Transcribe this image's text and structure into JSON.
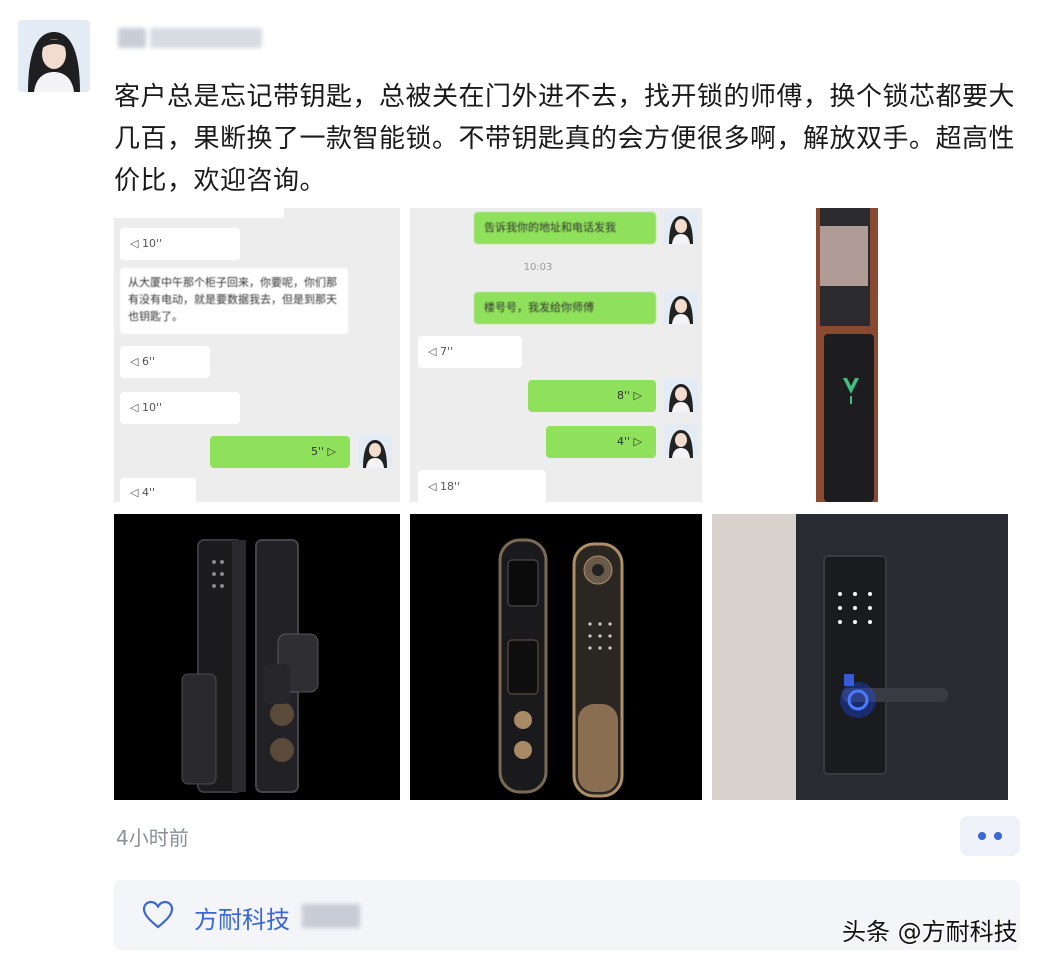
{
  "post": {
    "text": "客户总是忘记带钥匙，总被关在门外进不去，找开锁的师傅，换个锁芯都要大几百，果断换了一款智能锁。不带钥匙真的会方便很多啊，解放双手。超高性价比，欢迎咨询。",
    "time": "4小时前"
  },
  "chat1": {
    "v1": "◁ 10''",
    "msg": "从大厦中午那个柜子回来，你要呢，你们那有没有电动，就是要数据我去，但是到那天也钥匙了。",
    "v2": "◁ 6''",
    "v3": "◁ 10''",
    "g1": "5'' ▷",
    "v4": "◁ 4''"
  },
  "chat2": {
    "g1": "告诉我你的地址和电话发我",
    "time": "10:03",
    "g2": "楼号号，我发给你师傅",
    "v1": "◁ 7''",
    "g3": "8'' ▷",
    "g4": "4'' ▷",
    "v2": "◁ 18''"
  },
  "likes": {
    "name": "方耐科技"
  },
  "watermark": "头条 @方耐科技",
  "icons": [
    "heart-icon",
    "more-dots-icon"
  ],
  "colors": {
    "accent": "#3a67d6",
    "wechat_green": "#8fe05a",
    "chat_bg": "#ededed"
  }
}
